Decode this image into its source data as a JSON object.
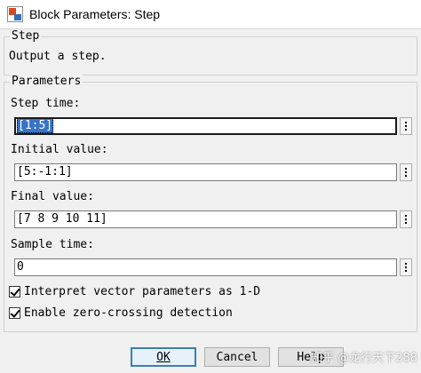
{
  "window": {
    "title": "Block Parameters: Step",
    "icon": "simulink-block-icon"
  },
  "description": {
    "group_title": "Step",
    "text": "Output a step."
  },
  "parameters": {
    "group_title": "Parameters",
    "fields": [
      {
        "label": "Step time:",
        "value": "[1:5]"
      },
      {
        "label": "Initial value:",
        "value": "[5:-1:1]"
      },
      {
        "label": "Final value:",
        "value": "[7 8 9 10 11]"
      },
      {
        "label": "Sample time:",
        "value": "0"
      }
    ],
    "checkboxes": [
      {
        "label": "Interpret vector parameters as 1-D",
        "checked": true
      },
      {
        "label": "Enable zero-crossing detection",
        "checked": true
      }
    ]
  },
  "buttons": {
    "ok": "OK",
    "cancel": "Cancel",
    "help": "Help"
  },
  "watermark": "知乎 @龙行天下288",
  "colors": {
    "selection": "#3874c8",
    "default_button_border": "#3c7fb1",
    "background": "#f0f0f0"
  }
}
